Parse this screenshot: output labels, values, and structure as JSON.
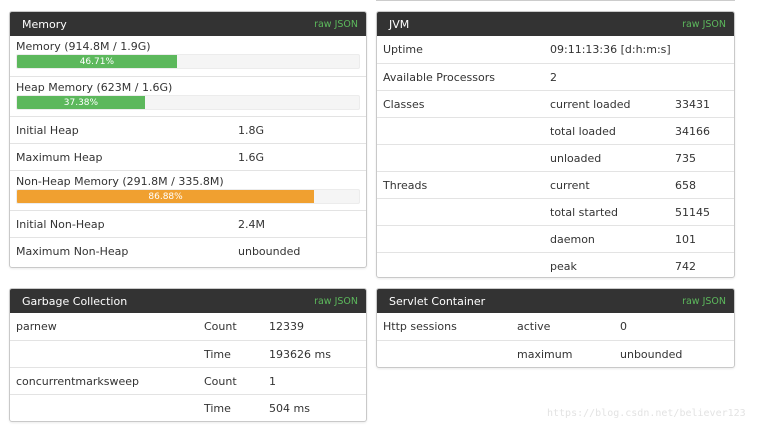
{
  "colors": {
    "header_bg": "#333333",
    "raw_json_link": "#5cb85c",
    "bar_green": "#5cb85c",
    "bar_orange": "#f0a030"
  },
  "memory": {
    "title": "Memory",
    "raw_json": "raw JSON",
    "memory_label": "Memory (914.8M / 1.9G)",
    "memory_percent_label": "46.71%",
    "memory_percent": 46.71,
    "heap_label": "Heap Memory (623M / 1.6G)",
    "heap_percent_label": "37.38%",
    "heap_percent": 37.38,
    "initial_heap_label": "Initial Heap",
    "initial_heap_value": "1.8G",
    "maximum_heap_label": "Maximum Heap",
    "maximum_heap_value": "1.6G",
    "nonheap_label": "Non-Heap Memory (291.8M / 335.8M)",
    "nonheap_percent_label": "86.88%",
    "nonheap_percent": 86.88,
    "initial_nonheap_label": "Initial Non-Heap",
    "initial_nonheap_value": "2.4M",
    "maximum_nonheap_label": "Maximum Non-Heap",
    "maximum_nonheap_value": "unbounded"
  },
  "jvm": {
    "title": "JVM",
    "raw_json": "raw JSON",
    "uptime_label": "Uptime",
    "uptime_value": "09:11:13:36 [d:h:m:s]",
    "processors_label": "Available Processors",
    "processors_value": "2",
    "classes_label": "Classes",
    "classes": [
      {
        "label": "current loaded",
        "value": "33431"
      },
      {
        "label": "total loaded",
        "value": "34166"
      },
      {
        "label": "unloaded",
        "value": "735"
      }
    ],
    "threads_label": "Threads",
    "threads": [
      {
        "label": "current",
        "value": "658"
      },
      {
        "label": "total started",
        "value": "51145"
      },
      {
        "label": "daemon",
        "value": "101"
      },
      {
        "label": "peak",
        "value": "742"
      }
    ]
  },
  "gc": {
    "title": "Garbage Collection",
    "raw_json": "raw JSON",
    "collectors": [
      {
        "name": "parnew",
        "count_label": "Count",
        "count_value": "12339",
        "time_label": "Time",
        "time_value": "193626 ms"
      },
      {
        "name": "concurrentmarksweep",
        "count_label": "Count",
        "count_value": "1",
        "time_label": "Time",
        "time_value": "504 ms"
      }
    ]
  },
  "servlet": {
    "title": "Servlet Container",
    "raw_json": "raw JSON",
    "sessions_label": "Http sessions",
    "active_label": "active",
    "active_value": "0",
    "maximum_label": "maximum",
    "maximum_value": "unbounded"
  },
  "watermark": "https://blog.csdn.net/believer123"
}
